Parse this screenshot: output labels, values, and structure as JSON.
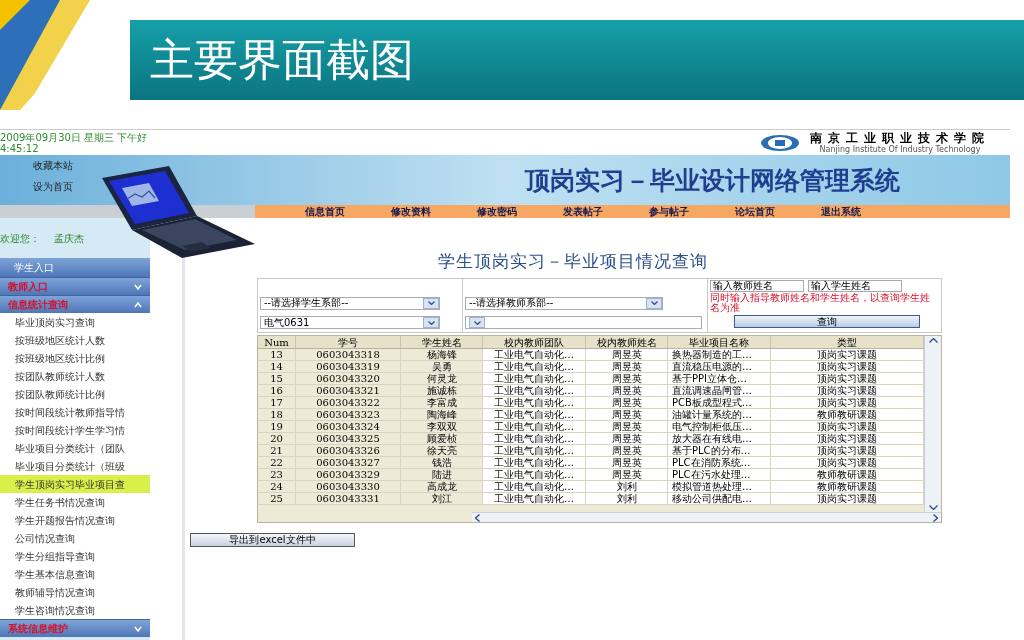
{
  "slide": {
    "title": "主要界面截图"
  },
  "page_header": {
    "date": "2009年09月30日  星期三  下午好",
    "time": "4:45:12",
    "school_name": "南京工业职业技术学院",
    "school_name_en": "Nanjing Institute Of Industry Technology"
  },
  "banner": {
    "links": [
      "收藏本站",
      "设为首页"
    ],
    "title": "顶岗实习－毕业设计网络管理系统"
  },
  "nav": [
    "信息首页",
    "修改资料",
    "修改密码",
    "发表帖子",
    "参与帖子",
    "论坛首页",
    "退出系统"
  ],
  "welcome": {
    "label": "欢迎您：",
    "user": "孟庆杰"
  },
  "sidebar": [
    {
      "label": "学生入口",
      "kind": "link"
    },
    {
      "label": "教师入口",
      "kind": "section",
      "expanded": false
    },
    {
      "label": "信息统计查询",
      "kind": "section",
      "expanded": true,
      "children": [
        {
          "label": "毕业顶岗实习查询",
          "selected": false
        },
        {
          "label": "按班级地区统计人数",
          "selected": false
        },
        {
          "label": "按班级地区统计比例",
          "selected": false
        },
        {
          "label": "按团队教师统计人数",
          "selected": false
        },
        {
          "label": "按团队教师统计比例",
          "selected": false
        },
        {
          "label": "按时间段统计教师指导情",
          "selected": false
        },
        {
          "label": "按时间段统计学生学习情",
          "selected": false
        },
        {
          "label": "毕业项目分类统计（团队",
          "selected": false
        },
        {
          "label": "毕业项目分类统计（班级",
          "selected": false
        },
        {
          "label": "学生顶岗实习毕业项目查",
          "selected": true
        },
        {
          "label": "学生任务书情况查询",
          "selected": false
        },
        {
          "label": "学生开题报告情况查询",
          "selected": false
        },
        {
          "label": "公司情况查询",
          "selected": false
        },
        {
          "label": "学生分组指导查询",
          "selected": false
        },
        {
          "label": "学生基本信息查询",
          "selected": false
        },
        {
          "label": "教师辅导情况查询",
          "selected": false
        },
        {
          "label": "学生咨询情况查询",
          "selected": false
        }
      ]
    },
    {
      "label": "系统信息维护",
      "kind": "section",
      "expanded": false
    }
  ],
  "content": {
    "title": "学生顶岗实习－毕业项目情况查询",
    "filters": {
      "student_dept": "--请选择学生系部--",
      "teacher_dept": "--请选择教师系部--",
      "student_class": "电气0631",
      "teacher_name": "输入教师姓名",
      "student_name": "输入学生姓名",
      "hint": "同时输入指导教师姓名和学生姓名，以查询学生姓名为准",
      "search_button": "查询"
    },
    "table": {
      "columns": [
        "Num",
        "学号",
        "学生姓名",
        "校内教师团队",
        "校内教师姓名",
        "毕业项目名称",
        "类型"
      ],
      "rows": [
        [
          "13",
          "0603043318",
          "杨海锋",
          "工业电气自动化…",
          "周昱英",
          "换热器制造的工…",
          "顶岗实习课题"
        ],
        [
          "14",
          "0603043319",
          "吴勇",
          "工业电气自动化…",
          "周昱英",
          "直流稳压电源的…",
          "顶岗实习课题"
        ],
        [
          "15",
          "0603043320",
          "何灵龙",
          "工业电气自动化…",
          "周昱英",
          "基于PPI立体仓…",
          "顶岗实习课题"
        ],
        [
          "16",
          "0603043321",
          "施诚栋",
          "工业电气自动化…",
          "周昱英",
          "直流调速晶闸管…",
          "顶岗实习课题"
        ],
        [
          "17",
          "0603043322",
          "李富成",
          "工业电气自动化…",
          "周昱英",
          "PCB板成型程式…",
          "顶岗实习课题"
        ],
        [
          "18",
          "0603043323",
          "陶海峰",
          "工业电气自动化…",
          "周昱英",
          "油罐计量系统的…",
          "教师教研课题"
        ],
        [
          "19",
          "0603043324",
          "李双双",
          "工业电气自动化…",
          "周昱英",
          "电气控制柜低压…",
          "顶岗实习课题"
        ],
        [
          "20",
          "0603043325",
          "顾爱桢",
          "工业电气自动化…",
          "周昱英",
          "放大器在有线电…",
          "顶岗实习课题"
        ],
        [
          "21",
          "0603043326",
          "徐天亮",
          "工业电气自动化…",
          "周昱英",
          "基于PLC的分布…",
          "顶岗实习课题"
        ],
        [
          "22",
          "0603043327",
          "钱浩",
          "工业电气自动化…",
          "周昱英",
          "PLC在消防系统…",
          "顶岗实习课题"
        ],
        [
          "23",
          "0603043329",
          "陆进",
          "工业电气自动化…",
          "周昱英",
          "PLC在污水处理…",
          "教师教研课题"
        ],
        [
          "24",
          "0603043330",
          "高成龙",
          "工业电气自动化…",
          "刘利",
          "模拟管道热处理…",
          "教师教研课题"
        ],
        [
          "25",
          "0603043331",
          "刘江",
          "工业电气自动化…",
          "刘利",
          "移动公司供配电…",
          "顶岗实习课题"
        ]
      ]
    },
    "export_button": "导出到excel文件中"
  }
}
